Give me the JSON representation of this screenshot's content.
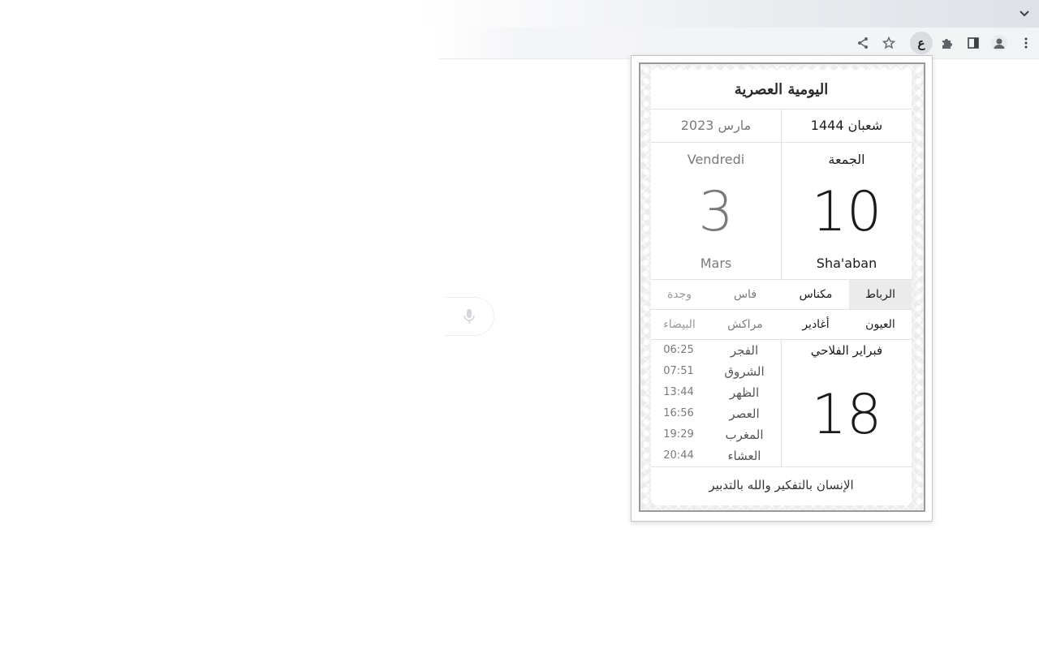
{
  "browser": {
    "toolbar_icons": [
      "share-icon",
      "star-icon",
      "extension-arabic-icon",
      "puzzle-icon",
      "side-panel-icon",
      "profile-icon",
      "more-icon"
    ],
    "extension_glyph": "ع",
    "active_extension": "extension-arabic-icon",
    "tab_search_icon": "chevron-down-icon"
  },
  "popup": {
    "title": "اليومية العصرية",
    "hijri_month": "شعبان 1444",
    "gregorian_month": "مارس 2023",
    "hijri_day_name": "الجمعة",
    "gregorian_day_name": "Vendredi",
    "hijri_day": "10",
    "gregorian_day": "3",
    "hijri_month_name": "Sha'aban",
    "gregorian_month_name": "Mars",
    "cities_row1": [
      "الرباط",
      "مكناس",
      "فاس",
      "وجدة"
    ],
    "cities_row2": [
      "العيون",
      "أغادير",
      "مراكش",
      "البيضاء"
    ],
    "selected_city": "الرباط",
    "prayers": [
      {
        "name": "الفجر",
        "time": "06:25"
      },
      {
        "name": "الشروق",
        "time": "07:51"
      },
      {
        "name": "الظهر",
        "time": "13:44"
      },
      {
        "name": "العصر",
        "time": "16:56"
      },
      {
        "name": "المغرب",
        "time": "19:29"
      },
      {
        "name": "العشاء",
        "time": "20:44"
      }
    ],
    "falahi_month": "فبراير الفلاحي",
    "falahi_day": "18",
    "quote": "الإنسان بالتفكير والله بالتدبير"
  }
}
